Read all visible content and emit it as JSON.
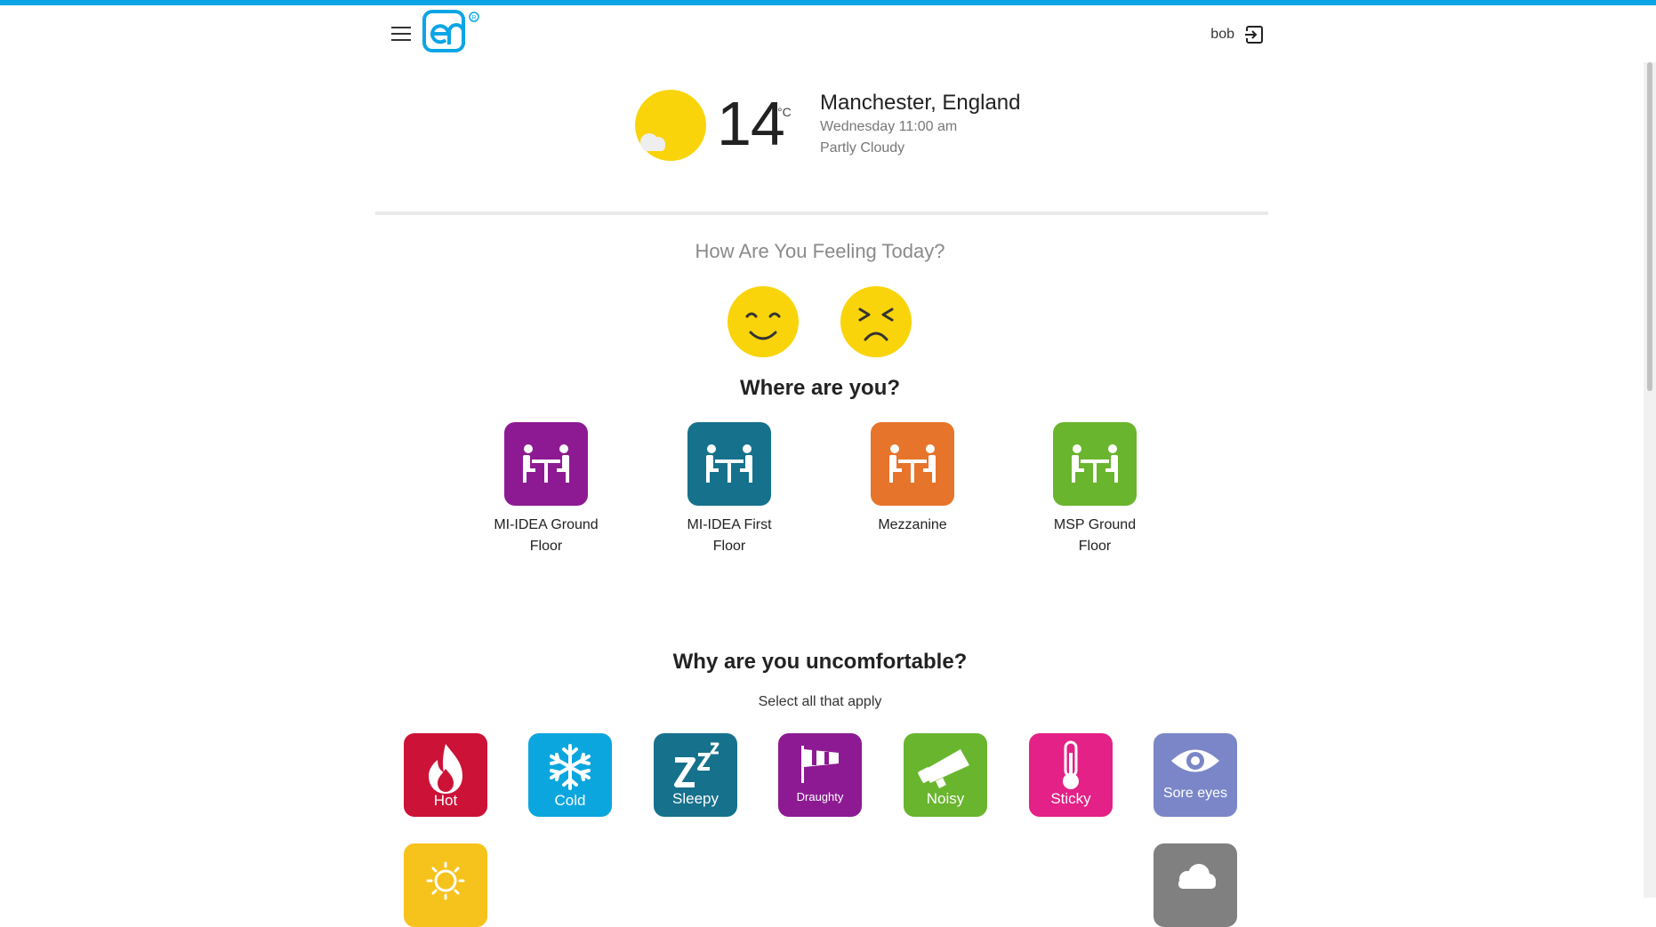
{
  "header": {
    "menu_icon": "hamburger-menu-icon",
    "logo_icon": "en-logo-icon",
    "user_name": "bob",
    "logout_icon": "logout-icon",
    "accent_color": "#0aa5e6"
  },
  "weather": {
    "icon": "partly-cloudy-icon",
    "temperature": "14",
    "unit": "°C",
    "location": "Manchester, England",
    "datetime": "Wednesday 11:00 am",
    "condition": "Partly Cloudy"
  },
  "feeling": {
    "question": "How Are You Feeling Today?",
    "options": [
      {
        "icon": "happy-face-icon"
      },
      {
        "icon": "unhappy-face-icon"
      }
    ]
  },
  "where": {
    "question": "Where are you?",
    "locations": [
      {
        "label": "MI-IDEA Ground Floor",
        "color": "#8d1a93"
      },
      {
        "label": "MI-IDEA First Floor",
        "color": "#16718c"
      },
      {
        "label": "Mezzanine",
        "color": "#e6742b"
      },
      {
        "label": "MSP Ground Floor",
        "color": "#69b52e"
      }
    ]
  },
  "why": {
    "question": "Why are you uncomfortable?",
    "hint": "Select all that apply",
    "reasons": [
      {
        "label": "Hot",
        "icon": "flame-icon",
        "color": "#cc1237"
      },
      {
        "label": "Cold",
        "icon": "snowflake-icon",
        "color": "#0ba6de"
      },
      {
        "label": "Sleepy",
        "icon": "zzz-icon",
        "color": "#16718c"
      },
      {
        "label": "Draughty",
        "icon": "windsock-icon",
        "color": "#8d1a93"
      },
      {
        "label": "Noisy",
        "icon": "megaphone-icon",
        "color": "#69b52e"
      },
      {
        "label": "Sticky",
        "icon": "thermometer-icon",
        "color": "#e32186"
      },
      {
        "label": "Sore eyes",
        "icon": "eye-icon",
        "color": "#7a86c7"
      },
      {
        "label": "",
        "icon": "bright-sun-icon",
        "color": "#f6c21c"
      },
      {
        "label": "",
        "icon": "cloud-icon",
        "color": "#808080"
      }
    ]
  }
}
